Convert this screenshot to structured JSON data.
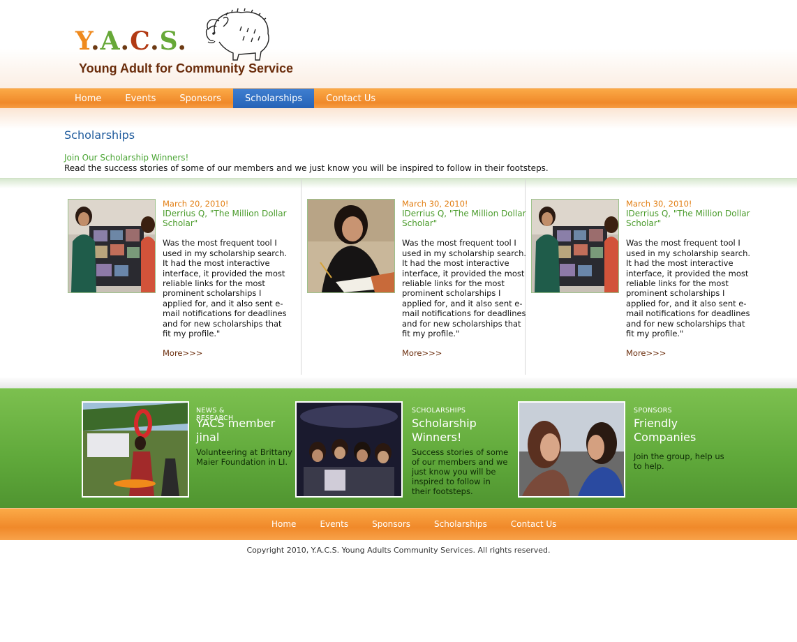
{
  "header": {
    "logo_letters": [
      "Y",
      ".",
      "A",
      ".",
      "C",
      ".",
      "S",
      "."
    ],
    "tagline": "Young Adult for Community Service"
  },
  "nav": {
    "items": [
      "Home",
      "Events",
      "Sponsors",
      "Scholarships",
      "Contact Us"
    ],
    "active": "Scholarships"
  },
  "intro": {
    "title": "Scholarships",
    "subtitle": "Join Our Scholarship Winners!",
    "text": "Read the success stories of some of our members and we just know you will be inspired to follow in their footsteps."
  },
  "stories": [
    {
      "date": "March 20, 2010!",
      "title": "IDerrius Q, \"The Million Dollar Scholar\"",
      "text": "Was the most frequent tool I used in my scholarship search. It had the most interactive interface, it provided the most reliable links for the most prominent scholarships I applied for, and it also sent e-mail notifications for deadlines and for new scholarships that fit my profile.\"",
      "more": "More>>>"
    },
    {
      "date": "March 30, 2010!",
      "title": "IDerrius Q, \"The Million Dollar Scholar\"",
      "text": "Was the most frequent tool I used in my scholarship search. It had the most interactive interface, it provided the most reliable links for the most prominent scholarships I applied for, and it also sent e-mail notifications for deadlines and for new scholarships that fit my profile.\"",
      "more": "More>>>"
    },
    {
      "date": "March 30, 2010!",
      "title": "IDerrius Q, \"The Million Dollar Scholar\"",
      "text": "Was the most frequent tool I used in my scholarship search. It had the most interactive interface, it provided the most reliable links for the most prominent scholarships I applied for, and it also sent e-mail notifications for deadlines and for new scholarships that fit my profile.\"",
      "more": "More>>>"
    }
  ],
  "features": [
    {
      "kicker": "NEWS & RESEARCH",
      "title": "YACS member jinal",
      "desc": "Volunteering at Brittany Maier Foundation in LI."
    },
    {
      "kicker": "SCHOLARSHIPS",
      "title": "Scholarship Winners!",
      "desc": "Success stories of some of our members and we just know you will be inspired to follow in their footsteps."
    },
    {
      "kicker": "SPONSORS",
      "title": "Friendly Companies",
      "desc": "Join the group, help us to help."
    }
  ],
  "footer": {
    "nav": [
      "Home",
      "Events",
      "Sponsors",
      "Scholarships",
      "Contact Us"
    ],
    "copyright": "Copyright 2010, Y.A.C.S. Young Adults Community Services. All rights reserved."
  },
  "colors": {
    "orange": "#f0892a",
    "green": "#5fa83a",
    "active_tab": "#2561b6",
    "title_blue": "#1e5a9c"
  }
}
